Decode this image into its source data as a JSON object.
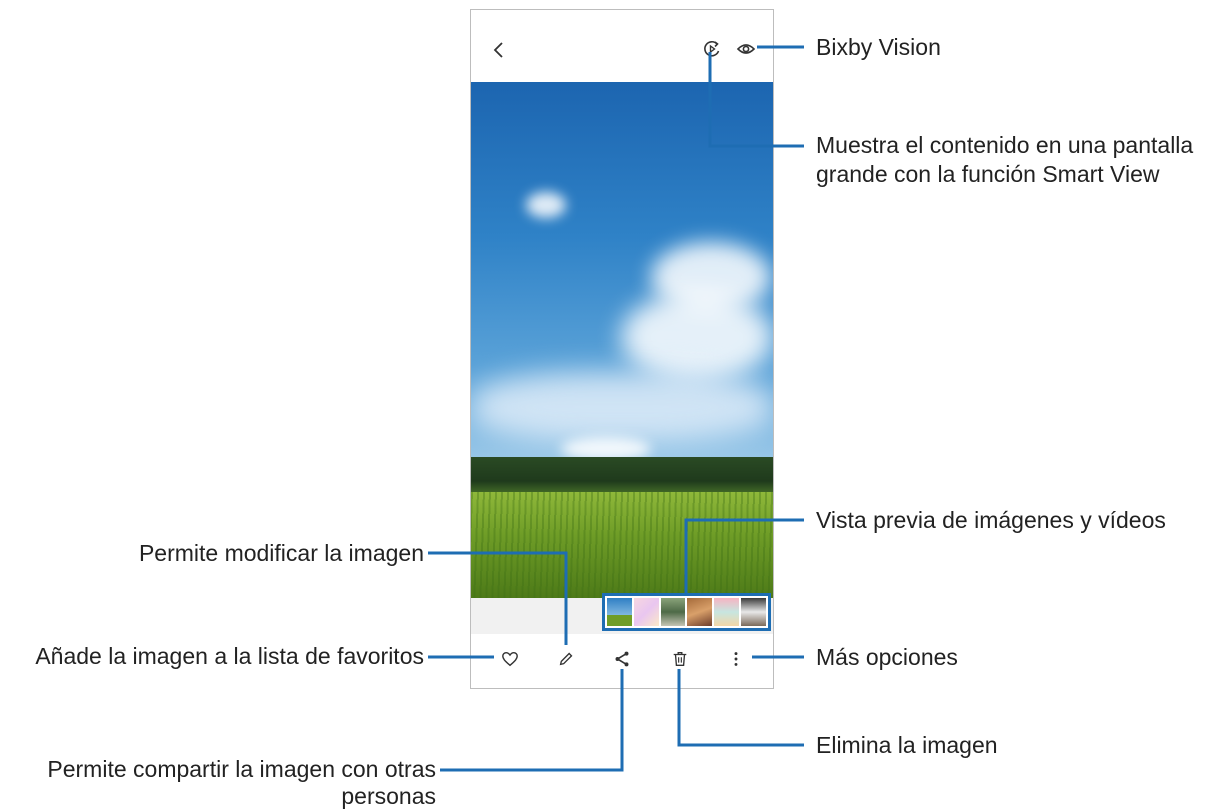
{
  "colors": {
    "accent": "#1e6db3",
    "frame": "#bdbdbd",
    "sky": "#2f82c7",
    "field": "#6f9d27"
  },
  "icons": {
    "back": "chevron-left-icon",
    "smart_view": "smart-view-icon",
    "bixby": "eye-icon",
    "favorite": "heart-icon",
    "edit": "pencil-icon",
    "share": "share-icon",
    "delete": "trash-icon",
    "more": "more-vertical-icon"
  },
  "annotations": {
    "bixby_vision": "Bixby Vision",
    "smart_view_line1": "Muestra el contenido en una pantalla",
    "smart_view_line2": "grande con la función Smart View",
    "preview": "Vista previa de imágenes y vídeos",
    "edit": "Permite modificar la imagen",
    "favorites": "Añade la imagen a la lista de favoritos",
    "more": "Más opciones",
    "delete": "Elimina la imagen",
    "share_line1": "Permite compartir la imagen con otras",
    "share_line2": "personas"
  }
}
